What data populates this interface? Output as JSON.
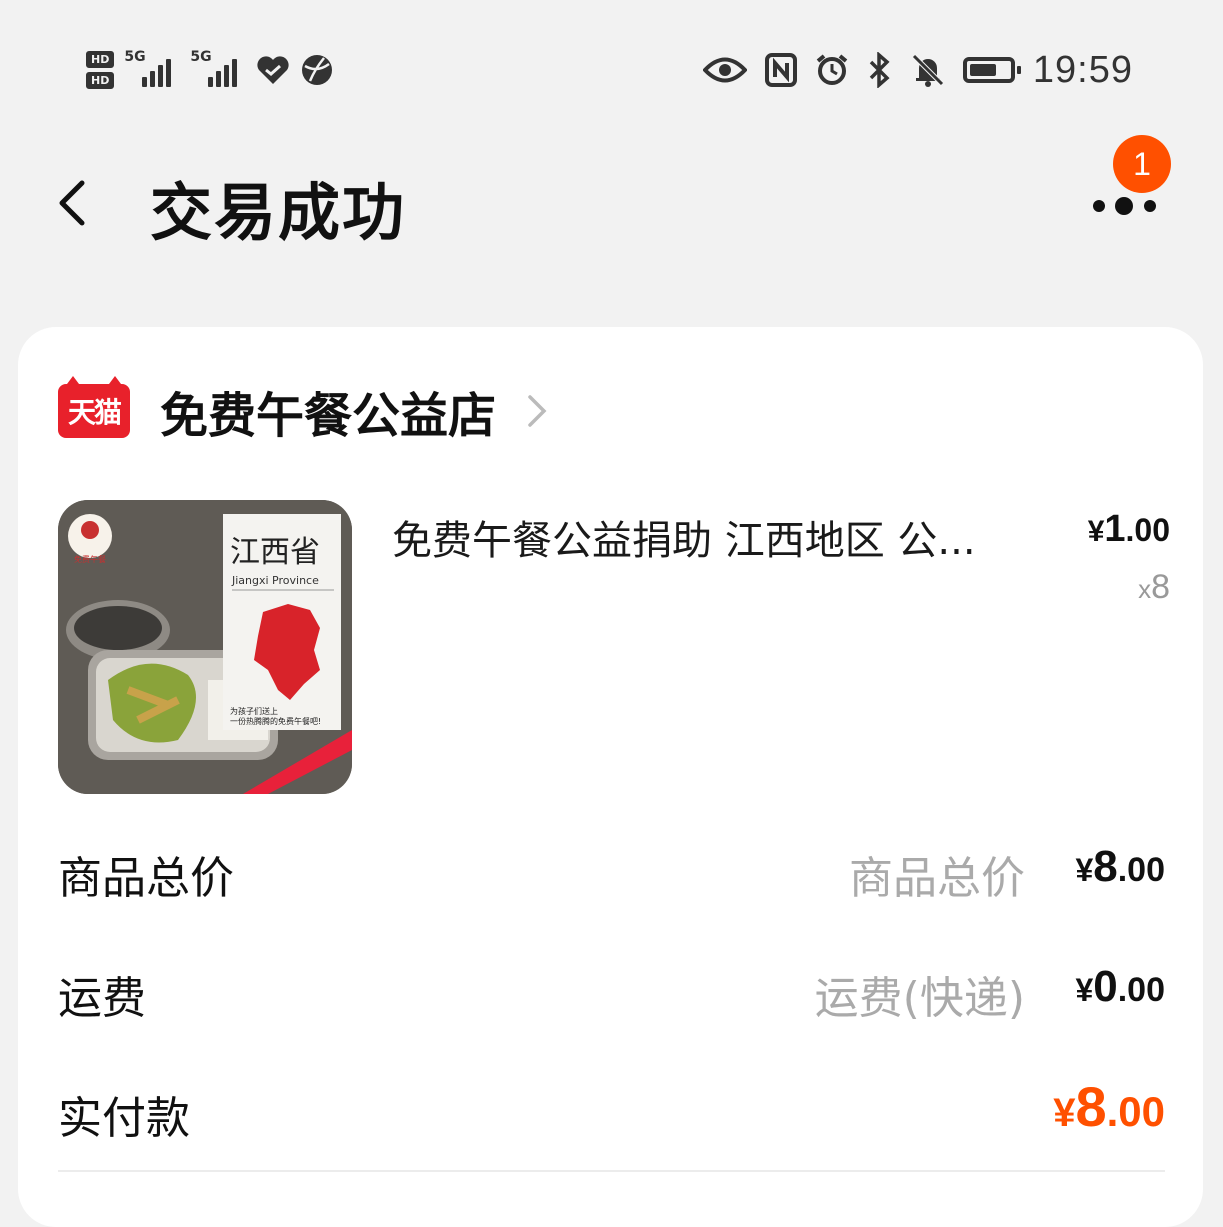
{
  "status_bar": {
    "hd1": "HD",
    "hd2": "HD",
    "signal1": "5G",
    "signal2": "5G",
    "time": "19:59"
  },
  "header": {
    "title": "交易成功",
    "badge_count": "1"
  },
  "shop": {
    "platform_label": "天猫",
    "name": "免费午餐公益店"
  },
  "product": {
    "title": "免费午餐公益捐助 江西地区 公...",
    "price_currency": "¥",
    "price_int": "1",
    "price_dec": ".00",
    "qty_prefix": "x",
    "qty": "8",
    "image_texts": {
      "province": "江西省",
      "province_en": "Jiangxi Province",
      "slogan1": "为孩子们送上",
      "slogan2": "一份热腾腾的免费午餐吧!",
      "logo": "免费午餐"
    }
  },
  "summary": {
    "goods": {
      "label": "商品总价",
      "sub": "商品总价",
      "currency": "¥",
      "int": "8",
      "dec": ".00"
    },
    "shipping": {
      "label": "运费",
      "sub": "运费(快递)",
      "currency": "¥",
      "int": "0",
      "dec": ".00"
    },
    "paid": {
      "label": "实付款",
      "currency": "¥",
      "int": "8",
      "dec": ".00"
    }
  },
  "colors": {
    "accent": "#ff5000",
    "tmall_red": "#e8212b",
    "background": "#f2f2f2"
  }
}
